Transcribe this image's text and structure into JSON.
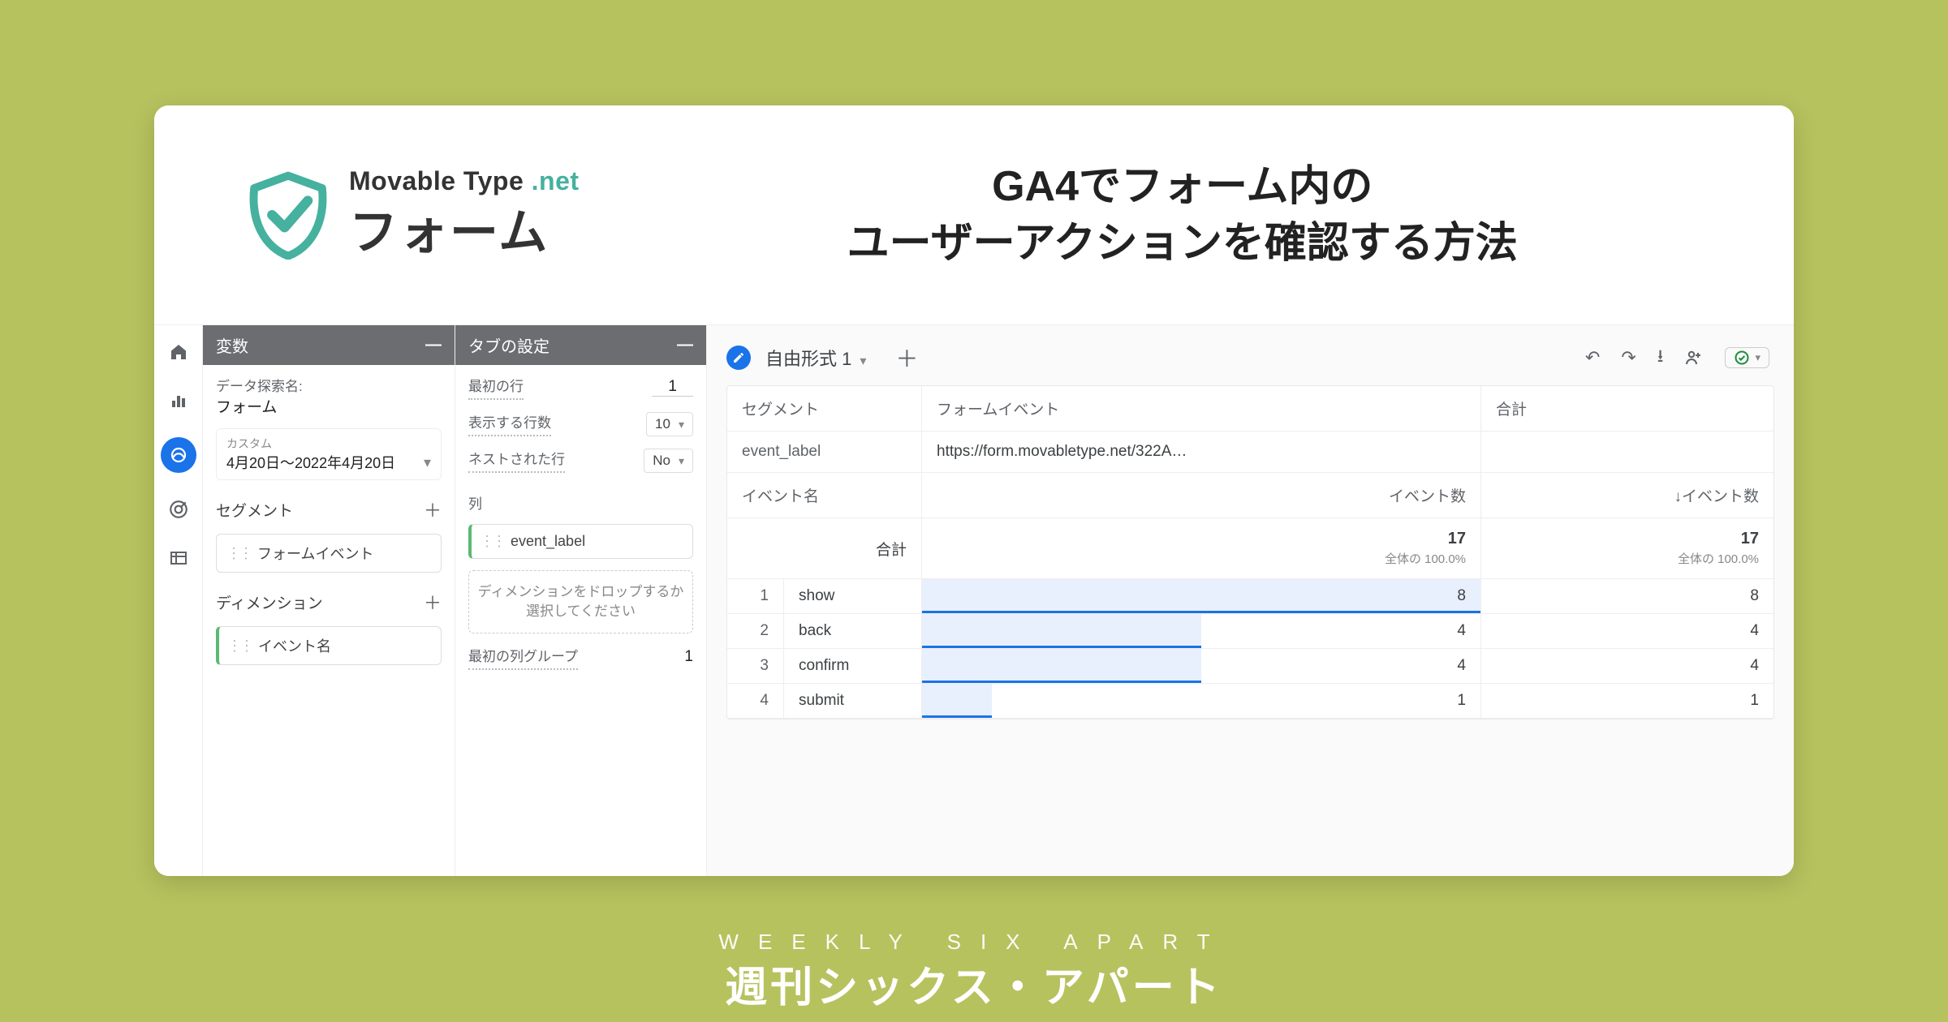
{
  "hero": {
    "brand_top_a": "Movable Type",
    "brand_top_b": ".net",
    "brand_main": "フォーム",
    "headline_l1": "GA4でフォーム内の",
    "headline_l2": "ユーザーアクションを確認する方法"
  },
  "panel_vars": {
    "title": "変数",
    "explore_label": "データ探索名:",
    "explore_value": "フォーム",
    "date_hint": "カスタム",
    "date_value": "4月20日～2022年4月20日",
    "seg_label": "セグメント",
    "seg_chip": "フォームイベント",
    "dim_label": "ディメンション",
    "dim_chip": "イベント名"
  },
  "panel_tab": {
    "title": "タブの設定",
    "first_row_label": "最初の行",
    "first_row_value": "1",
    "rows_label": "表示する行数",
    "rows_value": "10",
    "nested_label": "ネストされた行",
    "nested_value": "No",
    "col_label": "列",
    "col_chip": "event_label",
    "dropzone": "ディメンションをドロップするか選択してください",
    "colgroup_label": "最初の列グループ",
    "colgroup_value": "1"
  },
  "report": {
    "tab_name": "自由形式 1",
    "h_seg": "セグメント",
    "h_formev": "フォームイベント",
    "h_total": "合計",
    "h_evlabel": "event_label",
    "h_url": "https://form.movabletype.net/322A…",
    "h_evname": "イベント名",
    "h_evcount": "イベント数",
    "h_evcount_sort": "↓イベント数",
    "total_label": "合計",
    "total_value1": "17",
    "total_pct1": "全体の 100.0%",
    "total_value2": "17",
    "total_pct2": "全体の 100.0%"
  },
  "chart_data": {
    "type": "table",
    "columns": [
      "イベント名",
      "イベント数(フォームイベント)",
      "イベント数(合計)"
    ],
    "rows": [
      {
        "idx": "1",
        "name": "show",
        "v1": 8,
        "v2": 8
      },
      {
        "idx": "2",
        "name": "back",
        "v1": 4,
        "v2": 4
      },
      {
        "idx": "3",
        "name": "confirm",
        "v1": 4,
        "v2": 4
      },
      {
        "idx": "4",
        "name": "submit",
        "v1": 1,
        "v2": 1
      }
    ],
    "max": 8
  },
  "footer": {
    "en": "WEEKLY SIX APART",
    "jp": "週刊シックス・アパート"
  }
}
